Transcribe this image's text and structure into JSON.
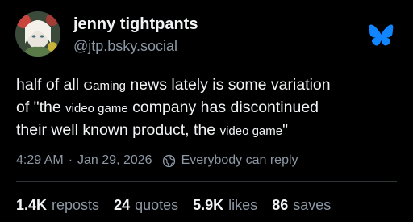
{
  "author": {
    "display_name": "jenny tightpants",
    "handle": "@jtp.bsky.social",
    "avatar_icon": "profile-avatar"
  },
  "brand": {
    "logo_icon": "bluesky-butterfly-icon",
    "color": "#1185fe"
  },
  "post": {
    "line1_a": "half of all ",
    "line1_small": "Gaming",
    "line1_b": " news lately is some variation",
    "line2_a": "of \"the ",
    "line2_small": "video game",
    "line2_b": " company has discontinued",
    "line3_a": "their well known product, the ",
    "line3_small": "video game",
    "line3_b": "\""
  },
  "meta": {
    "time": "4:29 AM",
    "separator": "·",
    "date": "Jan 29, 2026",
    "reply_setting": "Everybody can reply",
    "reply_icon": "reply-permission-icon"
  },
  "stats": [
    {
      "count": "1.4K",
      "label": "reposts"
    },
    {
      "count": "24",
      "label": "quotes"
    },
    {
      "count": "5.9K",
      "label": "likes"
    },
    {
      "count": "86",
      "label": "saves"
    }
  ],
  "colors": {
    "background": "#000000",
    "text": "#f1f3f5",
    "muted": "#8d98a5",
    "divider": "#2e3438"
  }
}
